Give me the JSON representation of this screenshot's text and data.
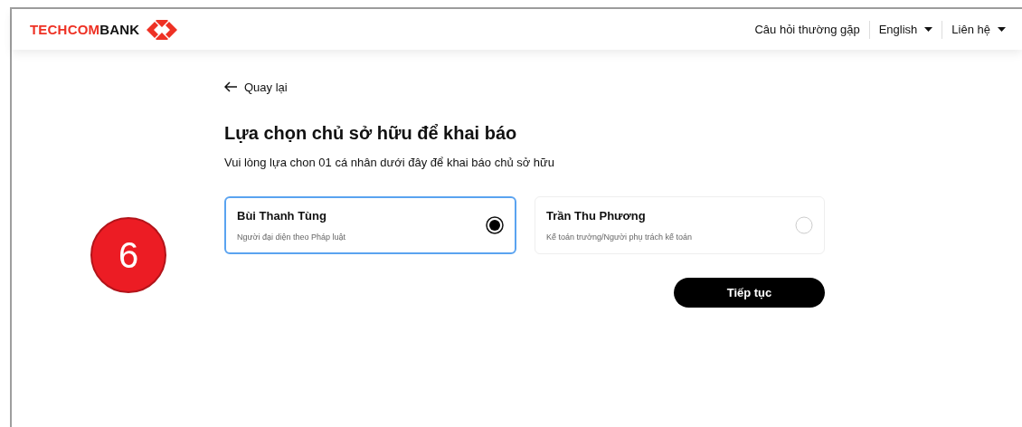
{
  "header": {
    "logo_parts": [
      {
        "text": "TECHCOM",
        "color": "#ee3124"
      },
      {
        "text": "BANK",
        "color": "#111111"
      }
    ],
    "nav": [
      {
        "label": "Câu hỏi thường gặp",
        "dropdown": false
      },
      {
        "label": "English",
        "dropdown": true
      },
      {
        "label": "Liên hệ",
        "dropdown": true
      }
    ]
  },
  "back_link": "Quay lại",
  "title": "Lựa chọn chủ sở hữu để khai báo",
  "subtitle": "Vui lòng lựa chon 01 cá nhân dưới đây để khai báo chủ sở hữu",
  "options": [
    {
      "name": "Bùi Thanh Tùng",
      "role": "Người đại diện theo Pháp luật",
      "selected": true
    },
    {
      "name": "Trần Thu Phương",
      "role": "Kế toán trưởng/Người phụ trách kế toán",
      "selected": false
    }
  ],
  "continue_button": "Tiếp tục",
  "step_badge": "6"
}
